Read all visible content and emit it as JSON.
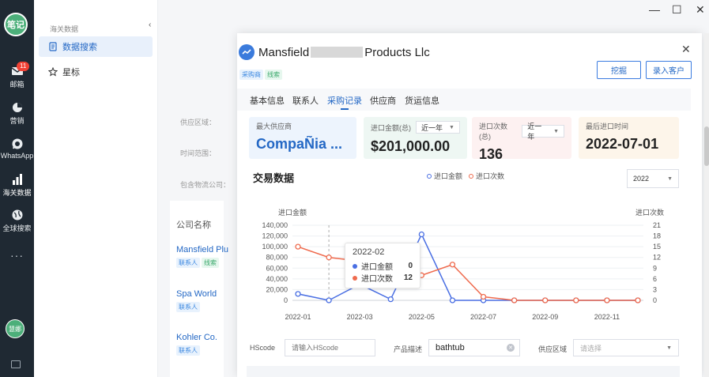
{
  "rail": {
    "logo": "笔记",
    "items": [
      {
        "label": "邮箱",
        "badge": "11",
        "icon": "mail-icon"
      },
      {
        "label": "营销",
        "icon": "pie-chart-icon"
      },
      {
        "label": "WhatsApp",
        "icon": "whatsapp-icon"
      },
      {
        "label": "海关数据",
        "icon": "bar-chart-icon"
      },
      {
        "label": "全球搜索",
        "icon": "globe-icon"
      }
    ],
    "more": "···",
    "user": "慧娜"
  },
  "sidebar": {
    "section": "海关数据",
    "items": [
      {
        "label": "数据搜索",
        "icon": "document-icon"
      },
      {
        "label": "星标",
        "icon": "star-icon"
      }
    ],
    "collapse_icon": "‹"
  },
  "background": {
    "filters": [
      "供应区域：",
      "时间范围：",
      "包含物流公司："
    ],
    "column_header": "公司名称",
    "companies": [
      {
        "name": "Mansfield Plu",
        "tags": [
          "联系人",
          "线索"
        ]
      },
      {
        "name": "Spa World",
        "tags": [
          "联系人"
        ]
      },
      {
        "name": "Kohler Co.",
        "tags": [
          "联系人"
        ]
      }
    ]
  },
  "window": {
    "minimize": "—",
    "maximize": "☐",
    "close": "✕"
  },
  "modal": {
    "title_left": "Mansfield",
    "title_right": "Products Llc",
    "tags": [
      "采购商",
      "线索"
    ],
    "close": "✕",
    "buttons": {
      "dig": "挖掘",
      "add_customer": "录入客户"
    },
    "tabs": [
      {
        "label": "基本信息",
        "active": false
      },
      {
        "label": "联系人",
        "active": false
      },
      {
        "label": "采购记录",
        "active": true
      },
      {
        "label": "供应商",
        "active": false
      },
      {
        "label": "货运信息",
        "active": false
      }
    ],
    "kpis": [
      {
        "label": "最大供应商",
        "value": "CompaÑia ...",
        "bg": "#edf4fd",
        "value_color": "#2468c5"
      },
      {
        "label": "进口金额(总)",
        "select": "近一年",
        "value": "$201,000.00",
        "bg": "#eef7f3",
        "value_color": "#222"
      },
      {
        "label": "进口次数(总)",
        "select": "近一年",
        "value": "136",
        "bg": "#fdf1f1",
        "value_color": "#222"
      },
      {
        "label": "最后进口时间",
        "value": "2022-07-01",
        "bg": "#fdf5ea",
        "value_color": "#222"
      }
    ],
    "section_title": "交易数据",
    "legend": [
      {
        "label": "进口金额",
        "color": "#4a6fe3"
      },
      {
        "label": "进口次数",
        "color": "#ef6b4e"
      }
    ],
    "year_select": "2022",
    "tooltip": {
      "title": "2022-02",
      "rows": [
        {
          "name": "进口金额",
          "value": "0",
          "color": "#4a6fe3"
        },
        {
          "name": "进口次数",
          "value": "12",
          "color": "#ef6b4e"
        }
      ]
    },
    "filters": {
      "hscode_label": "HScode",
      "hscode_placeholder": "请输入HScode",
      "product_label": "产品描述",
      "product_value": "bathtub",
      "region_label": "供应区域",
      "region_placeholder": "请选择"
    }
  },
  "chart_data": {
    "type": "line",
    "x": [
      "2022-01",
      "2022-02",
      "2022-03",
      "2022-04",
      "2022-05",
      "2022-06",
      "2022-07",
      "2022-08",
      "2022-09",
      "2022-10",
      "2022-11",
      "2022-12"
    ],
    "x_tick_labels": [
      "2022-01",
      "2022-03",
      "2022-05",
      "2022-07",
      "2022-09",
      "2022-11"
    ],
    "ylabel_left": "进口金额",
    "ylabel_right": "进口次数",
    "y_left_ticks": [
      "0",
      "20,000",
      "40,000",
      "60,000",
      "80,000",
      "100,000",
      "120,000",
      "140,000"
    ],
    "y_right_ticks": [
      "0",
      "3",
      "6",
      "9",
      "12",
      "15",
      "18",
      "21"
    ],
    "ylim_left": [
      0,
      140000
    ],
    "ylim_right": [
      0,
      21
    ],
    "series": [
      {
        "name": "进口金额",
        "axis": "left",
        "color": "#4a6fe3",
        "values": [
          12000,
          0,
          30000,
          2000,
          123000,
          0,
          0,
          0,
          0,
          0,
          0,
          0
        ]
      },
      {
        "name": "进口次数",
        "axis": "right",
        "color": "#ef6b4e",
        "values": [
          15,
          12,
          11,
          6,
          7,
          10,
          1,
          0,
          0,
          0,
          0,
          0
        ]
      }
    ],
    "grid": true,
    "legend": "top-center"
  }
}
